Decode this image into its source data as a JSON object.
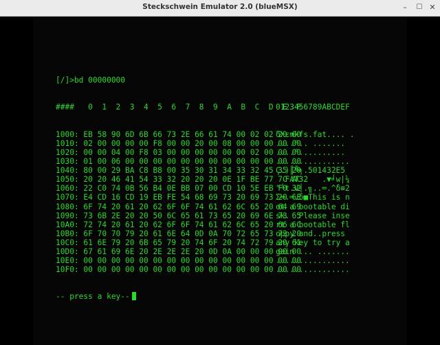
{
  "window": {
    "title": "Steckschwein Emulator 2.0 (blueMSX)",
    "min_glyph": "–",
    "max_glyph": "☐",
    "close_glyph": "✕"
  },
  "terminal": {
    "command": "[/]>bd 00000000",
    "header_hex": "####   0  1  2  3  4  5  6  7  8  9  A  B  C  D  E  F",
    "header_ascii": "0123456789ABCDEF",
    "rows": [
      {
        "addr": "1000:",
        "hex": "EB 58 90 6D 6B 66 73 2E 66 61 74 00 02 02 20 00",
        "ascii": "δXεmkfs.fat.... ."
      },
      {
        "addr": "1010:",
        "hex": "02 00 00 00 00 F8 00 00 20 00 08 00 00 00 00 00",
        "ascii": "....°.. ......."
      },
      {
        "addr": "1020:",
        "hex": "00 00 04 00 F8 03 00 00 00 00 00 00 02 00 00 00",
        "ascii": "....°.........."
      },
      {
        "addr": "1030:",
        "hex": "01 00 06 00 00 00 00 00 00 00 00 00 00 00 00 00",
        "ascii": "................"
      },
      {
        "addr": "1040:",
        "hex": "80 00 29 BA C8 B8 00 35 30 31 34 33 32 45 35 20",
        "ascii": "Ç.)║╚╕.501432E5 "
      },
      {
        "addr": "1050:",
        "hex": "20 20 46 41 54 33 32 20 20 20 0E 1F BE 77 7C AC",
        "ascii": "  FAT32   .▼╛w|¼"
      },
      {
        "addr": "1060:",
        "hex": "22 C0 74 0B 56 B4 0E BB 07 00 CD 10 5E EB F0 32",
        "ascii": "\"└t.V┤.╗..═.^δ≡2"
      },
      {
        "addr": "1070:",
        "hex": "E4 CD 16 CD 19 EB FE 54 68 69 73 20 69 73 20 6E",
        "ascii": "Σ═.═.δ■This is n"
      },
      {
        "addr": "1080:",
        "hex": "6F 74 20 61 20 62 6F 6F 74 61 62 6C 65 20 64 69",
        "ascii": "ot a bootable di"
      },
      {
        "addr": "1090:",
        "hex": "73 6B 2E 20 20 50 6C 65 61 73 65 20 69 6E 73 65",
        "ascii": "sk.  Please inse"
      },
      {
        "addr": "10A0:",
        "hex": "72 74 20 61 20 62 6F 6F 74 61 62 6C 65 20 66 6C",
        "ascii": "rt a bootable fl"
      },
      {
        "addr": "10B0:",
        "hex": "6F 70 70 79 20 61 6E 64 0D 0A 70 72 65 73 73 20",
        "ascii": "oppy and..press "
      },
      {
        "addr": "10C0:",
        "hex": "61 6E 79 20 6B 65 79 20 74 6F 20 74 72 79 20 61",
        "ascii": "any key to try a"
      },
      {
        "addr": "10D0:",
        "hex": "67 61 69 6E 20 2E 2E 2E 20 0D 0A 00 00 00 00 00",
        "ascii": "gain ... ......."
      },
      {
        "addr": "10E0:",
        "hex": "00 00 00 00 00 00 00 00 00 00 00 00 00 00 00 00",
        "ascii": "................"
      },
      {
        "addr": "10F0:",
        "hex": "00 00 00 00 00 00 00 00 00 00 00 00 00 00 00 00",
        "ascii": "................"
      }
    ],
    "prompt": "-- press a key--"
  },
  "colors": {
    "phosphor_green": "#2bd92b",
    "screen_bg": "#050505",
    "titlebar_bg": "#ebebeb"
  }
}
